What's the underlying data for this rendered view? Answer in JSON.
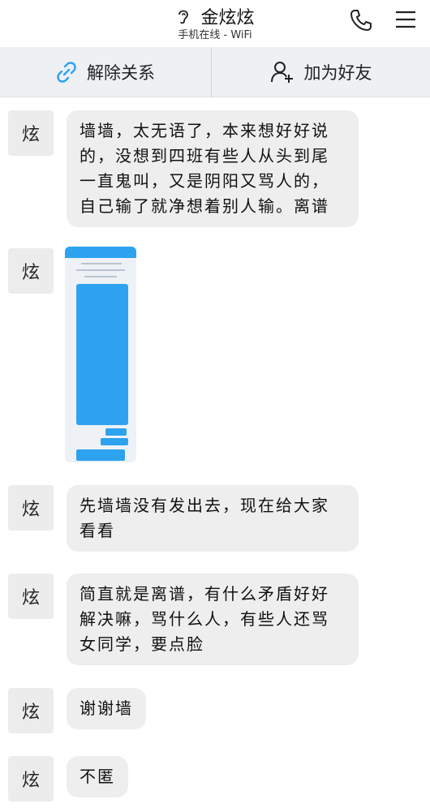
{
  "header": {
    "title": "金炫炫",
    "status": "手机在线 - WiFi"
  },
  "actions": {
    "unfriend": "解除关系",
    "add_friend": "加为好友"
  },
  "avatar_char": "炫",
  "messages": [
    {
      "type": "text",
      "text": "墙墙，太无语了，本来想好好说的，没想到四班有些人从头到尾一直鬼叫，又是阴阳又骂人的，自己输了就净想着别人输。离谱"
    },
    {
      "type": "image"
    },
    {
      "type": "text",
      "text": "先墙墙没有发出去，现在给大家看看"
    },
    {
      "type": "text",
      "text": "简直就是离谱，有什么矛盾好好解决嘛，骂什么人，有些人还骂女同学，要点脸"
    },
    {
      "type": "text",
      "text": "谢谢墙"
    },
    {
      "type": "text",
      "text": "不匿"
    }
  ],
  "colors": {
    "accent": "#2da3f0",
    "bubble": "#eeeeee",
    "action_bar": "#eef0f4"
  }
}
